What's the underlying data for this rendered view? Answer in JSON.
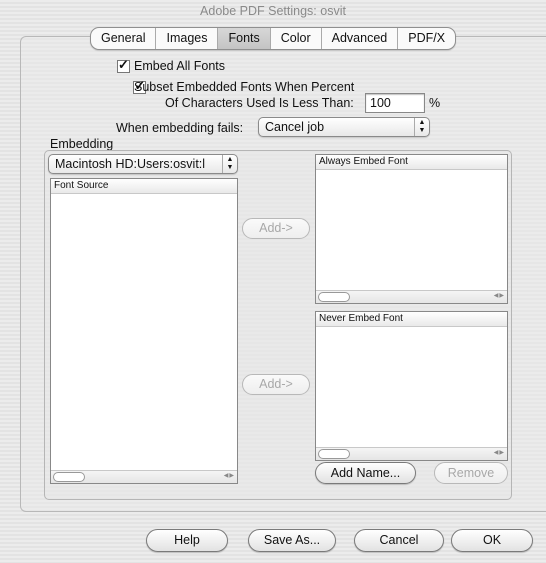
{
  "window": {
    "title": "Adobe PDF Settings: osvit"
  },
  "tabs": [
    "General",
    "Images",
    "Fonts",
    "Color",
    "Advanced",
    "PDF/X"
  ],
  "fonts_options": {
    "embed_all_fonts": {
      "label": "Embed All Fonts",
      "checked": true
    },
    "subset": {
      "label_line1": "Subset Embedded Fonts When Percent",
      "label_line2": "Of Characters Used Is Less Than:",
      "value": "100",
      "unit": "%",
      "checked": true
    },
    "when_fails": {
      "label": "When embedding fails:",
      "value": "Cancel job"
    }
  },
  "embedding": {
    "legend": "Embedding",
    "source_popup": "Macintosh HD:Users:osvit:l",
    "font_source_header": "Font Source",
    "always_header": "Always Embed Font",
    "never_header": "Never Embed Font",
    "add_label": "Add->",
    "add_name_label": "Add Name...",
    "remove_label": "Remove"
  },
  "footer": {
    "help": "Help",
    "save_as": "Save As...",
    "cancel": "Cancel",
    "ok": "OK"
  }
}
